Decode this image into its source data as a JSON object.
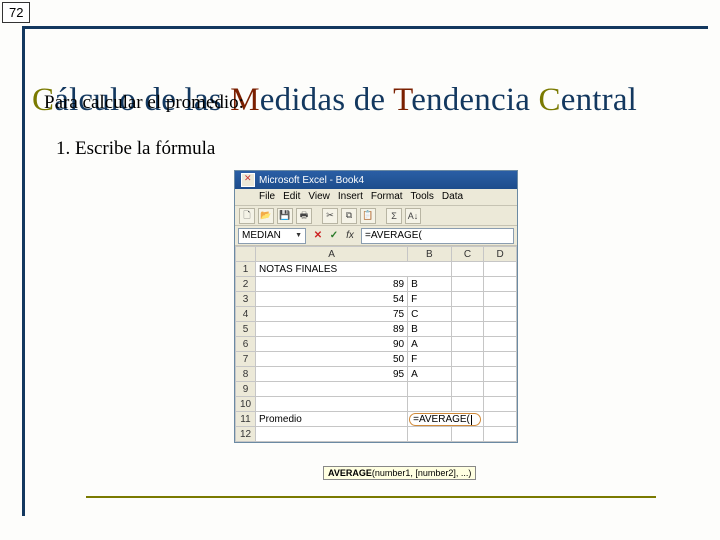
{
  "page_number": "72",
  "title": {
    "word1_first": "C",
    "word1_rest": "álculo de las ",
    "word2_first": "M",
    "word2_rest": "edidas de ",
    "word3_first": "T",
    "word3_rest": "endencia ",
    "word4_first": "C",
    "word4_rest": "entral"
  },
  "subtitle": "Para calcular el promedio:",
  "step": "1.  Escribe la fórmula",
  "excel": {
    "titlebar": "Microsoft Excel - Book4",
    "menu": {
      "file": "File",
      "edit": "Edit",
      "view": "View",
      "insert": "Insert",
      "format": "Format",
      "tools": "Tools",
      "data": "Data"
    },
    "toolbar": {
      "new": "🗋",
      "open": "📂",
      "save": "💾",
      "print": "🖶",
      "cut": "✂",
      "copy": "⧉",
      "paste": "📋",
      "sum": "Σ",
      "sort": "A↓"
    },
    "namebox": "MEDIAN",
    "fx_label": "fx",
    "formula": "=AVERAGE(",
    "cols": {
      "a": "A",
      "b": "B",
      "c": "C",
      "d": "D"
    },
    "rows": [
      {
        "n": "1",
        "a": "NOTAS FINALES",
        "b": "",
        "c": "",
        "d": ""
      },
      {
        "n": "2",
        "a": "89",
        "b": "B",
        "c": "",
        "d": ""
      },
      {
        "n": "3",
        "a": "54",
        "b": "F",
        "c": "",
        "d": ""
      },
      {
        "n": "4",
        "a": "75",
        "b": "C",
        "c": "",
        "d": ""
      },
      {
        "n": "5",
        "a": "89",
        "b": "B",
        "c": "",
        "d": ""
      },
      {
        "n": "6",
        "a": "90",
        "b": "A",
        "c": "",
        "d": ""
      },
      {
        "n": "7",
        "a": "50",
        "b": "F",
        "c": "",
        "d": ""
      },
      {
        "n": "8",
        "a": "95",
        "b": "A",
        "c": "",
        "d": ""
      },
      {
        "n": "9",
        "a": "",
        "b": "",
        "c": "",
        "d": ""
      },
      {
        "n": "10",
        "a": "",
        "b": "",
        "c": "",
        "d": ""
      },
      {
        "n": "11",
        "a": "Promedio",
        "b": "=AVERAGE(",
        "c": "",
        "d": ""
      },
      {
        "n": "12",
        "a": "",
        "b": "",
        "c": "",
        "d": ""
      }
    ],
    "tooltip": {
      "fn": "AVERAGE",
      "sig": "(number1, [number2], ...)"
    }
  }
}
